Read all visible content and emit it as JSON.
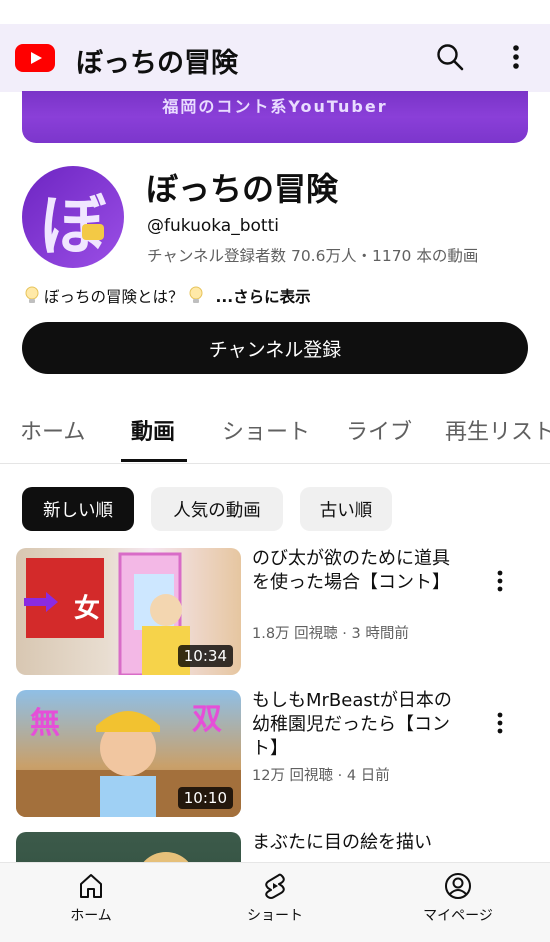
{
  "app": {
    "title": "ぼっちの冒険",
    "brand_color": "#ff0000"
  },
  "banner": {
    "text": "福岡のコント系YouTuber"
  },
  "channel": {
    "avatar_glyph": "ぼ",
    "name": "ぼっちの冒険",
    "handle": "@fukuoka_botti",
    "stats": "チャンネル登録者数 70.6万人・1170 本の動画",
    "description": "ぼっちの冒険とは？",
    "more_label": "...さらに表示",
    "subscribe_label": "チャンネル登録"
  },
  "tabs": [
    {
      "label": "ホーム",
      "active": false
    },
    {
      "label": "動画",
      "active": true
    },
    {
      "label": "ショート",
      "active": false
    },
    {
      "label": "ライブ",
      "active": false
    },
    {
      "label": "再生リスト",
      "active": false
    }
  ],
  "chips": [
    {
      "label": "新しい順",
      "selected": true
    },
    {
      "label": "人気の動画",
      "selected": false
    },
    {
      "label": "古い順",
      "selected": false
    }
  ],
  "videos": [
    {
      "title": "のび太が欲のために道具を使った場合【コント】",
      "meta": "1.8万 回視聴 · 3 時間前",
      "duration": "10:34",
      "thumb_text": "女"
    },
    {
      "title": "もしもMrBeastが日本の幼稚園児だったら【コント】",
      "meta": "12万 回視聴 · 4 日前",
      "duration": "10:10",
      "thumb_text_left": "無",
      "thumb_text_right": "双"
    },
    {
      "title": "まぶたに目の絵を描い",
      "meta": "",
      "duration": ""
    }
  ],
  "bottom_nav": [
    {
      "label": "ホーム",
      "icon": "home-icon"
    },
    {
      "label": "ショート",
      "icon": "shorts-icon"
    },
    {
      "label": "マイページ",
      "icon": "account-icon"
    }
  ]
}
